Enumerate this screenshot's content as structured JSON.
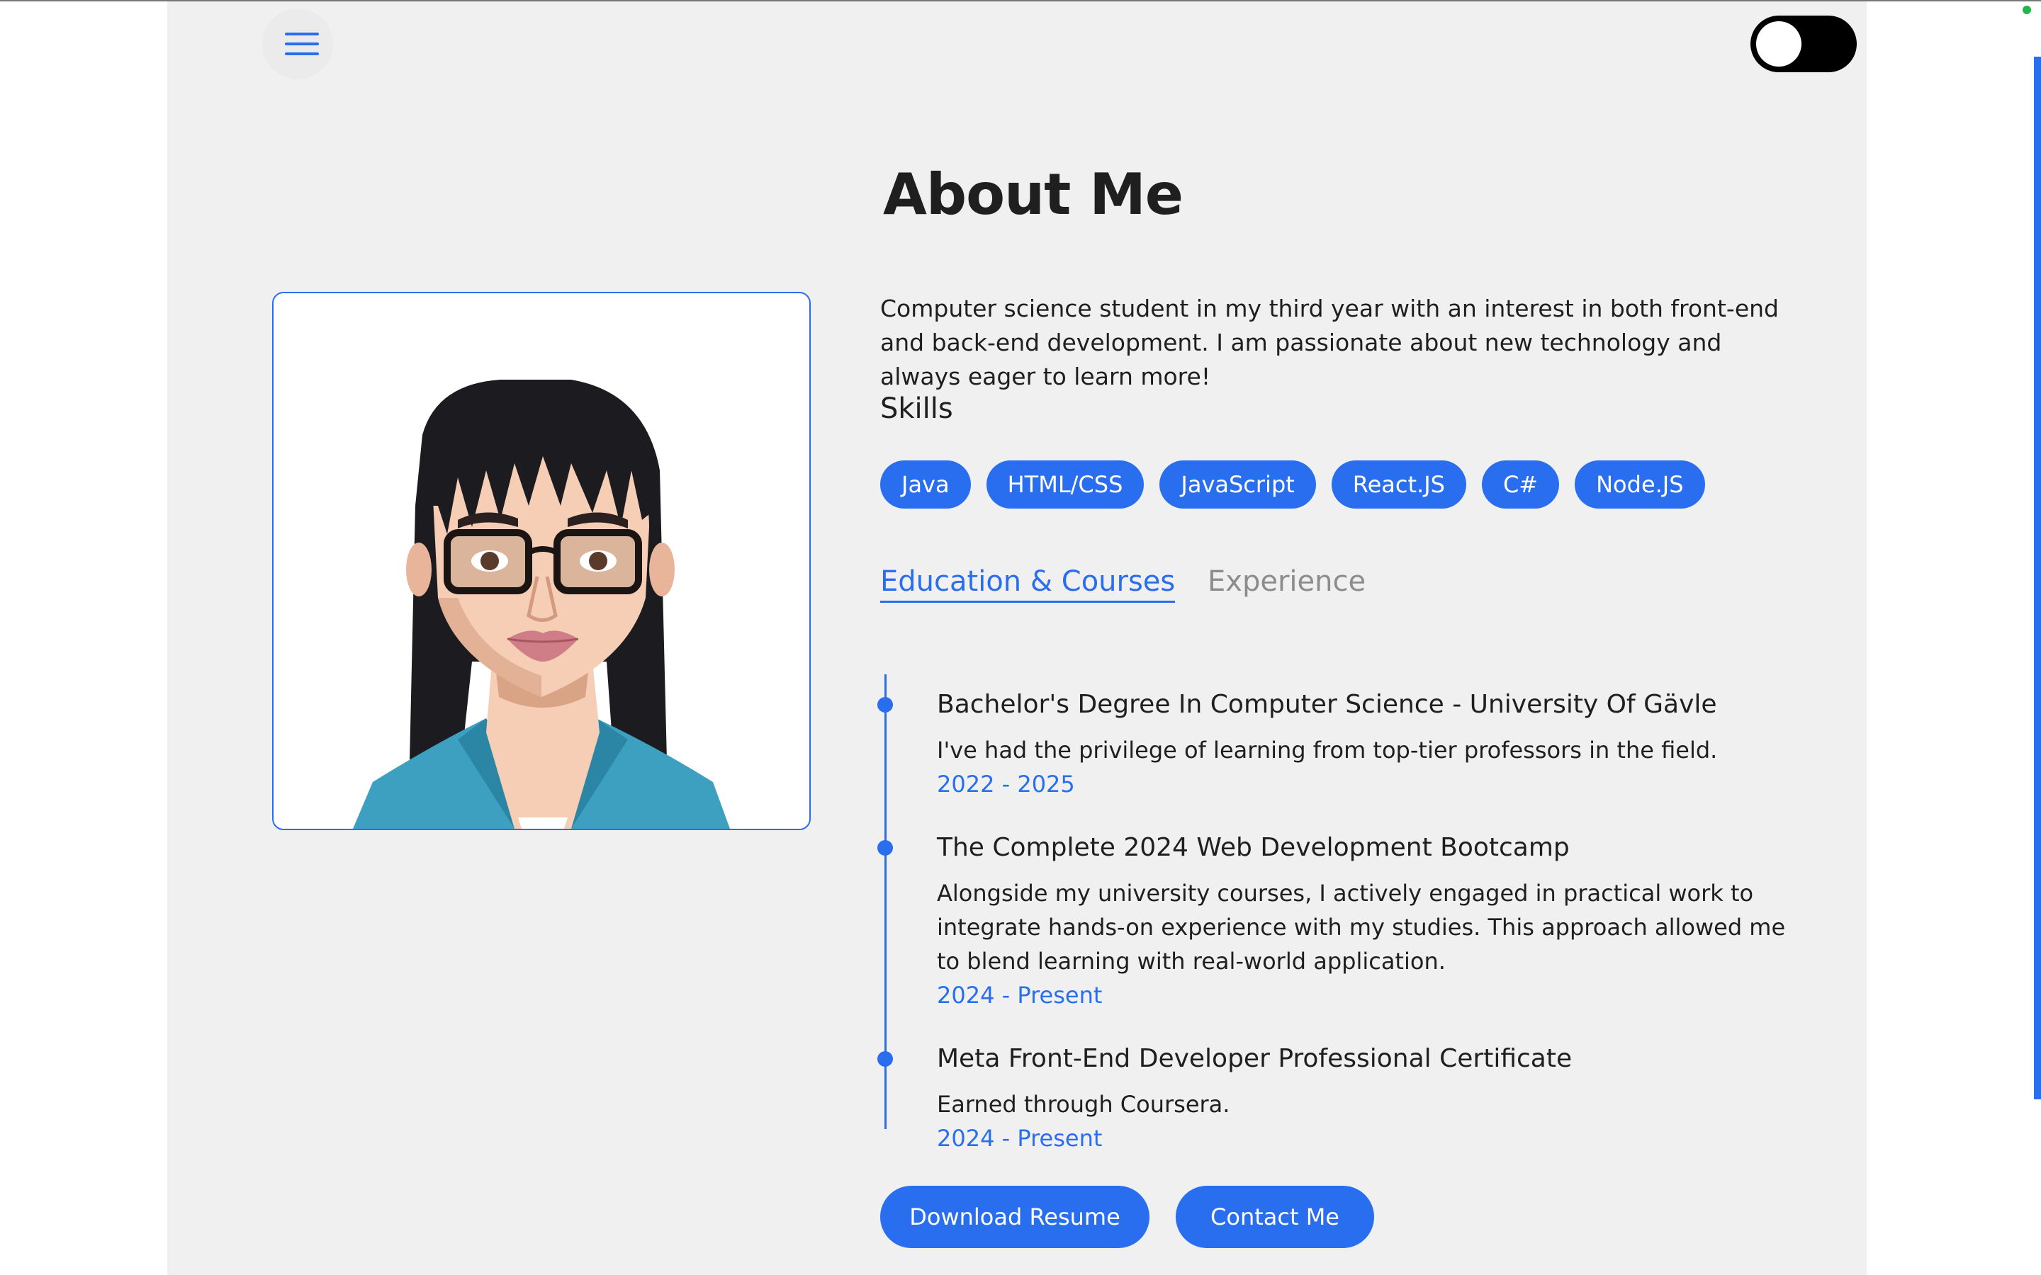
{
  "header": {
    "menu_icon": "hamburger-menu-icon",
    "theme_toggle": "dark-mode-toggle"
  },
  "about": {
    "title": "About Me",
    "bio": "Computer science student in my third year with an interest in both front-end and back-end development. I am passionate about new technology and always eager to learn more!",
    "profile_image": "avatar-illustration"
  },
  "skills": {
    "heading": "Skills",
    "items": [
      "Java",
      "HTML/CSS",
      "JavaScript",
      "React.JS",
      "C#",
      "Node.JS"
    ]
  },
  "tabs": {
    "active": "Education & Courses",
    "inactive": "Experience"
  },
  "education": [
    {
      "title_main": "Bachelor's Degree In Computer Science",
      "title_sep": " - ",
      "title_sub": "University Of Gävle",
      "description": "I've had the privilege of learning from top-tier professors in the field.",
      "dates": "2022 - 2025"
    },
    {
      "title_main": "The Complete 2024 Web Development Bootcamp",
      "title_sep": "",
      "title_sub": "",
      "description": "Alongside my university courses, I actively engaged in practical work to integrate hands-on experience with my studies. This approach allowed me to blend learning with real-world application.",
      "dates": "2024 - Present"
    },
    {
      "title_main": "Meta Front-End Developer Professional Certificate",
      "title_sep": "",
      "title_sub": "",
      "description": "Earned through Coursera.",
      "dates": "2024 - Present"
    }
  ],
  "actions": {
    "download_resume": "Download Resume",
    "contact_me": "Contact Me"
  },
  "colors": {
    "accent": "#2a6ef0",
    "panel": "#f0f0f0",
    "text": "#1f1f1f",
    "muted": "#8c8c8c"
  }
}
